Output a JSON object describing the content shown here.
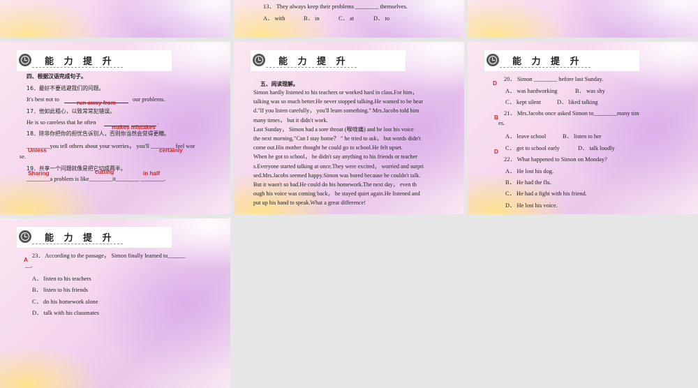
{
  "header": {
    "title": "能 力 提 升"
  },
  "top_slide": {
    "question": "13．  They always keep their problems ________ themselves.",
    "options": [
      "A．  with",
      "B．  in",
      "C．  at",
      "D．  to"
    ]
  },
  "slide1": {
    "section": "四、根据汉语完成句子。",
    "q16_cn": "16．最好不要逃避我们的问题。",
    "q16_left": "It's best not to",
    "q16_right": "our problems.",
    "q16_answer": "run away from",
    "q17_cn": "17．他如此粗心，以致常常犯错误。",
    "q17_left": "He is so careless that he often",
    "q17_right": ".",
    "q17_answer": "makes mistakes",
    "q18_cn": "18．除非你把你的担忧告诉别人，否则你当然会觉得更糟。",
    "q18_line1": "________you tell others about your worries，  you'll ________ feel wor",
    "q18_line2": "se.",
    "q18_answer1": "Unless",
    "q18_answer2": "certainly",
    "q19_cn": "19．共享一个问题就像是把它切成两半。",
    "q19_line": "________a problem is like________it________ ________.",
    "q19_answer1": "Sharing",
    "q19_answer2": "cutting",
    "q19_answer3": "in half"
  },
  "slide2": {
    "section": "五、阅读理解。",
    "passage": "    Simon hardly listened to his teachers or worked hard in class.For him，\ntalking was so much better.He never stopped talking.He wanted to be hear\nd.\"If you listen carefully，  you'll learn something.\" Mrs.Jacobs told him\nmany times，  but it didn't work.\n    Last Sunday，  Simon had a sore throat (喉咙痛) and he lost his voice\nthe next morning.\"Can I stay home？ \"  he tried to ask，  but words didn't\ncome out.His mother thought he could go to school.He felt upset.\n    When he got to school，  he didn't say anything to his friends or teacher\ns.Everyone started talking at once.They were excited，  worried and surpri\nsed.Mrs.Jacobs seemed happy.Simon was bored because he couldn't talk.\n    But it wasn't so bad.He could do his homework.The next day，  even th\nough his voice was coming back，  he stayed quiet again.He listened and\nput up his hand to speak.What a great difference!"
  },
  "slide3": {
    "q20": "20．  Simon ________ before last Sunday.",
    "q20_answer": "D",
    "q20_opts": [
      "A．  was hardworking",
      "B．  was shy",
      "C．  kept silent",
      "D．  liked talking"
    ],
    "q21_line1": "21．  Mrs.Jacobs once asked Simon to________many tim",
    "q21_line2": "es.",
    "q21_answer": "B",
    "q21_opts": [
      "A．  leave school",
      "B．  listen to her",
      "C．  get to school early",
      "D．  talk loudly"
    ],
    "q22": "22．  What happened to Simon on Monday?",
    "q22_answer": "D",
    "q22_opts": [
      "A．  He lost his dog.",
      "B．  He had the flu.",
      "C．  He had a fight with his friend.",
      "D．  He lost his voice."
    ]
  },
  "slide4": {
    "q23_line1": "23．  According to the passage，  Simon finally learned to______",
    "q23_line2": "__.",
    "q23_answer": "A",
    "q23_opts": [
      "A．  listen to his teachers",
      "B．  listen to his friends",
      "C．  do his homework alone",
      "D．  talk with his classmates"
    ]
  }
}
